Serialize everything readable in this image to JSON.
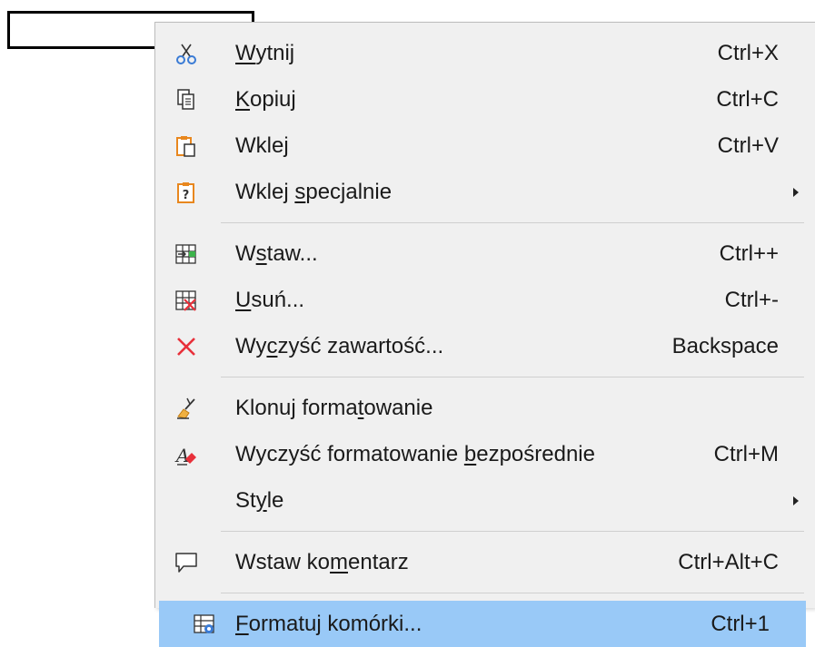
{
  "menu": {
    "items": [
      {
        "id": "cut",
        "pre": "",
        "acc": "W",
        "post": "ytnij",
        "shortcut": "Ctrl+X",
        "icon": "scissors-icon"
      },
      {
        "id": "copy",
        "pre": "",
        "acc": "K",
        "post": "opiuj",
        "shortcut": "Ctrl+C",
        "icon": "copy-icon"
      },
      {
        "id": "paste",
        "pre": "Wkle",
        "acc": "j",
        "post": "",
        "shortcut": "Ctrl+V",
        "icon": "paste-icon"
      },
      {
        "id": "paste-special",
        "pre": "Wklej ",
        "acc": "s",
        "post": "pecjalnie",
        "shortcut": "",
        "icon": "paste-special-icon",
        "submenu": true
      },
      {
        "id": "insert",
        "pre": "W",
        "acc": "s",
        "post": "taw...",
        "shortcut": "Ctrl++",
        "icon": "insert-cells-icon"
      },
      {
        "id": "delete",
        "pre": "",
        "acc": "U",
        "post": "suń...",
        "shortcut": "Ctrl+-",
        "icon": "delete-cells-icon"
      },
      {
        "id": "clear-contents",
        "pre": "Wy",
        "acc": "c",
        "post": "zyść zawartość...",
        "shortcut": "Backspace",
        "icon": "clear-x-icon"
      },
      {
        "id": "clone-formatting",
        "pre": "Klonuj forma",
        "acc": "t",
        "post": "owanie",
        "shortcut": "",
        "icon": "paintbrush-icon"
      },
      {
        "id": "clear-direct-formatting",
        "pre": "Wyczyść formatowanie ",
        "acc": "b",
        "post": "ezpośrednie",
        "shortcut": "Ctrl+M",
        "icon": "eraser-format-icon"
      },
      {
        "id": "style",
        "pre": "St",
        "acc": "y",
        "post": "le",
        "shortcut": "",
        "icon": "",
        "submenu": true
      },
      {
        "id": "insert-comment",
        "pre": "Wstaw ko",
        "acc": "m",
        "post": "entarz",
        "shortcut": "Ctrl+Alt+C",
        "icon": "comment-icon"
      },
      {
        "id": "format-cells",
        "pre": "",
        "acc": "F",
        "post": "ormatuj komórki...",
        "shortcut": "Ctrl+1",
        "icon": "format-cells-icon"
      }
    ]
  },
  "colors": {
    "highlight": "#99c9f7",
    "menu_bg": "#f0f0f0",
    "accent_orange": "#e8871e",
    "delete_red": "#e8303a"
  }
}
